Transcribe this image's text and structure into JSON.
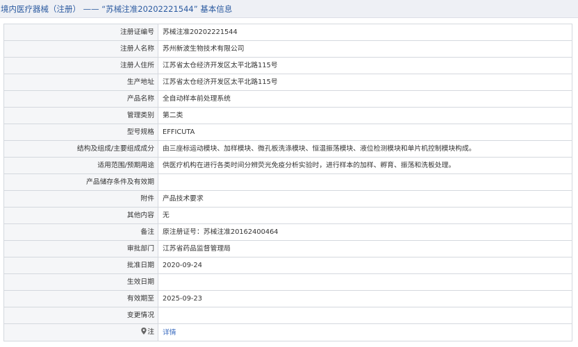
{
  "header": {
    "title": "境内医疗器械（注册） —— “苏械注准20202221544” 基本信息"
  },
  "rows": [
    {
      "label": "注册证编号",
      "value": "苏械注准20202221544"
    },
    {
      "label": "注册人名称",
      "value": "苏州新波生物技术有限公司"
    },
    {
      "label": "注册人住所",
      "value": "江苏省太仓经济开发区太平北路115号"
    },
    {
      "label": "生产地址",
      "value": "江苏省太仓经济开发区太平北路115号"
    },
    {
      "label": "产品名称",
      "value": "全自动样本前处理系统"
    },
    {
      "label": "管理类别",
      "value": "第二类"
    },
    {
      "label": "型号规格",
      "value": "EFFICUTA"
    },
    {
      "label": "结构及组成/主要组成成分",
      "value": "由三座标运动模块、加样模块、微孔板洗涤模块、恒温振荡模块、液位检测模块和单片机控制模块构成。"
    },
    {
      "label": "适用范围/预期用途",
      "value": "供医疗机构在进行各类时间分辨荧光免疫分析实验时，进行样本的加样、孵育、振荡和洗板处理。"
    },
    {
      "label": "产品储存条件及有效期",
      "value": ""
    },
    {
      "label": "附件",
      "value": "产品技术要求"
    },
    {
      "label": "其他内容",
      "value": "无"
    },
    {
      "label": "备注",
      "value": "原注册证号：苏械注准20162400464"
    },
    {
      "label": "审批部门",
      "value": "江苏省药品监督管理局"
    },
    {
      "label": "批准日期",
      "value": "2020-09-24"
    },
    {
      "label": "生效日期",
      "value": ""
    },
    {
      "label": "有效期至",
      "value": "2025-09-23"
    },
    {
      "label": "变更情况",
      "value": ""
    }
  ],
  "note_row": {
    "pin_icon": "location-pin-icon",
    "label": "注",
    "link_text": "详情"
  }
}
